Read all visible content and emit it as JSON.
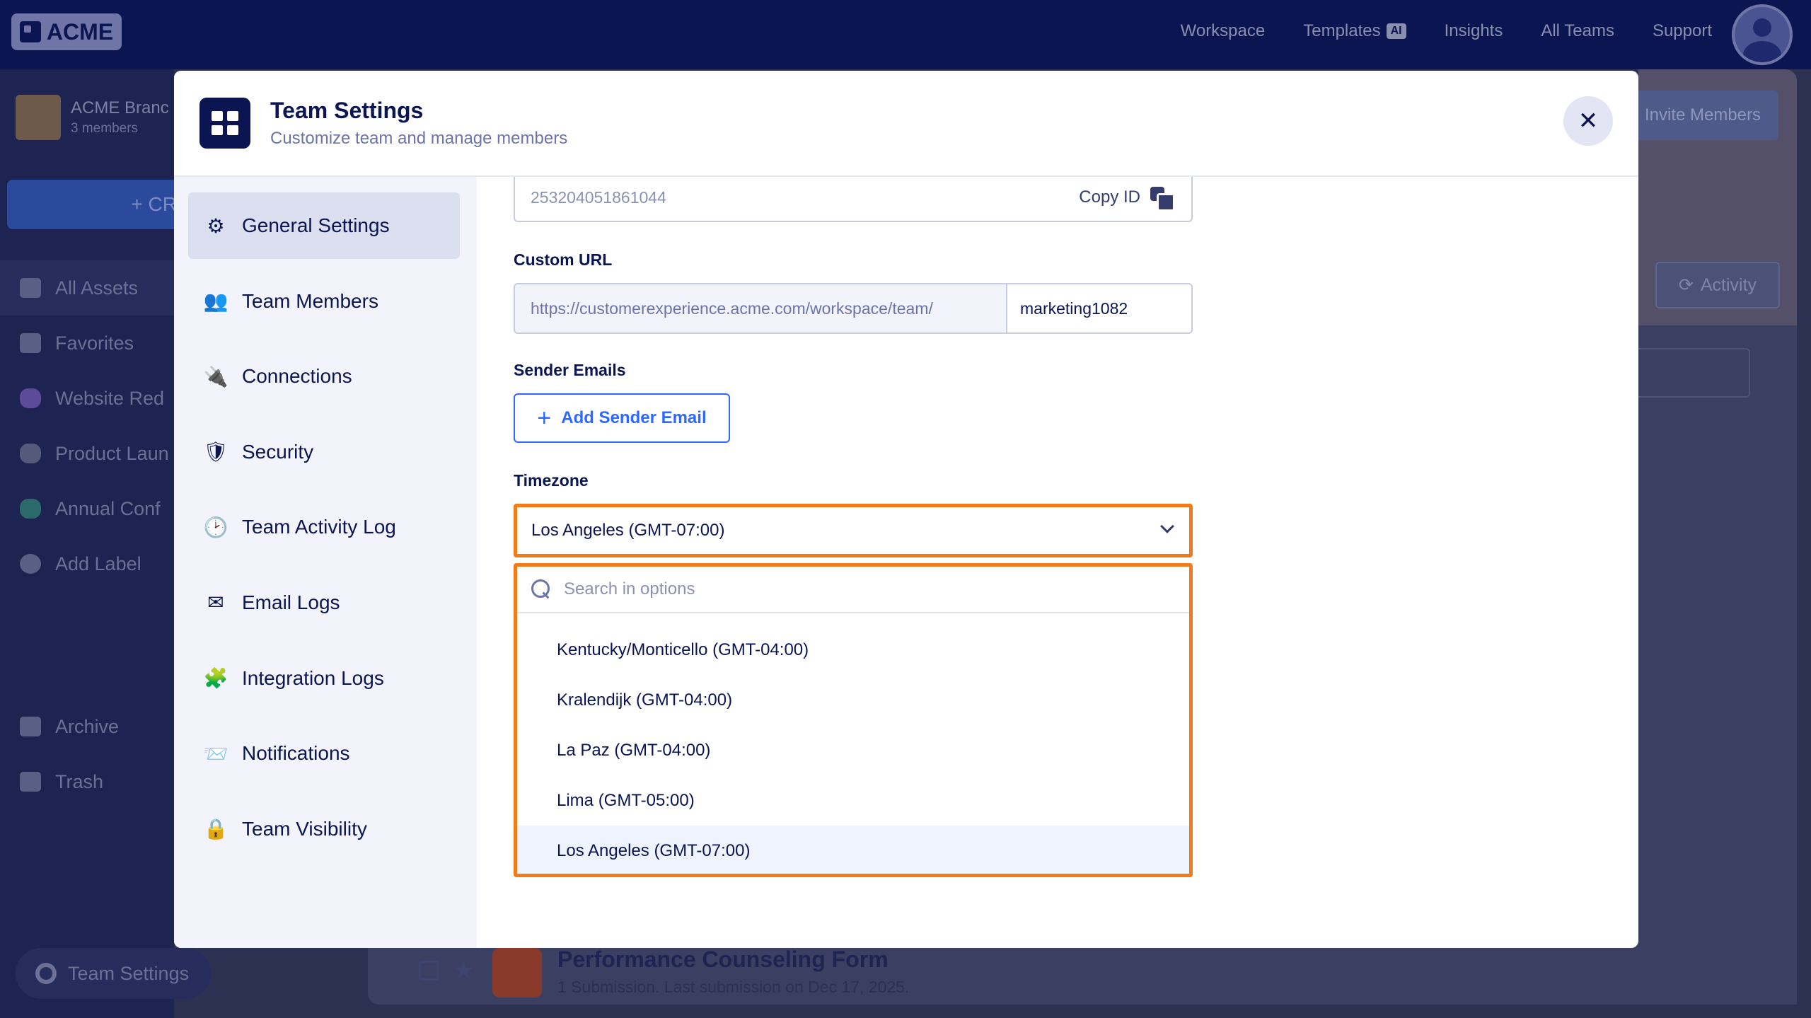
{
  "topbar": {
    "logo_text": "ACME",
    "nav": [
      {
        "label": "Workspace"
      },
      {
        "label": "Templates",
        "badge": "AI"
      },
      {
        "label": "Insights"
      },
      {
        "label": "All Teams"
      },
      {
        "label": "Support"
      }
    ]
  },
  "sidebar": {
    "team_name": "ACME Branc",
    "team_members": "3 members",
    "create_label": "+ CR",
    "items": [
      {
        "label": "All Assets",
        "icon": "grid-icon"
      },
      {
        "label": "Favorites",
        "icon": "star-icon"
      },
      {
        "label": "Website Red",
        "icon": "label-icon",
        "color": "#5c4b99"
      },
      {
        "label": "Product Laun",
        "icon": "label-icon",
        "color": "#555a7b"
      },
      {
        "label": "Annual Conf",
        "icon": "label-icon",
        "color": "#2a6a6a"
      },
      {
        "label": "Add Label",
        "icon": "plus-circle-icon"
      }
    ],
    "lower_items": [
      {
        "label": "Archive",
        "icon": "archive-icon"
      },
      {
        "label": "Trash",
        "icon": "trash-icon"
      }
    ],
    "team_settings_label": "Team Settings"
  },
  "background": {
    "invite_label": "Invite Members",
    "activity_label": "Activity",
    "form_title": "Performance Counseling Form",
    "form_sub": "1 Submission.  Last submission on Dec 17, 2025."
  },
  "modal": {
    "title": "Team Settings",
    "subtitle": "Customize team and manage members",
    "close_glyph": "✕",
    "nav": [
      {
        "label": "General Settings",
        "icon": "gear-icon",
        "glyph": "⚙"
      },
      {
        "label": "Team Members",
        "icon": "users-icon",
        "glyph": "👥"
      },
      {
        "label": "Connections",
        "icon": "plug-icon",
        "glyph": "🔌"
      },
      {
        "label": "Security",
        "icon": "shield-icon",
        "glyph": "🛡"
      },
      {
        "label": "Team Activity Log",
        "icon": "history-icon",
        "glyph": "🕑"
      },
      {
        "label": "Email Logs",
        "icon": "envelope-icon",
        "glyph": "✉"
      },
      {
        "label": "Integration Logs",
        "icon": "puzzle-icon",
        "glyph": "🧩"
      },
      {
        "label": "Notifications",
        "icon": "mail-notification-icon",
        "glyph": "📨"
      },
      {
        "label": "Team Visibility",
        "icon": "lock-icon",
        "glyph": "🔒"
      }
    ],
    "form": {
      "team_id": "253204051861044",
      "copy_id_label": "Copy ID",
      "custom_url_label": "Custom URL",
      "url_prefix": "https://customerexperience.acme.com/workspace/team/",
      "url_slug": "marketing1082",
      "sender_emails_label": "Sender Emails",
      "add_sender_label": "Add Sender Email",
      "timezone_label": "Timezone",
      "timezone_value": "Los Angeles (GMT-07:00)",
      "search_placeholder": "Search in options",
      "options": [
        "Kentucky/Monticello (GMT-04:00)",
        "Kralendijk (GMT-04:00)",
        "La Paz (GMT-04:00)",
        "Lima (GMT-05:00)",
        "Los Angeles (GMT-07:00)"
      ]
    }
  },
  "colors": {
    "navy": "#0a1551",
    "accent_blue": "#2e69ff",
    "highlight_orange": "#f07b1a"
  }
}
